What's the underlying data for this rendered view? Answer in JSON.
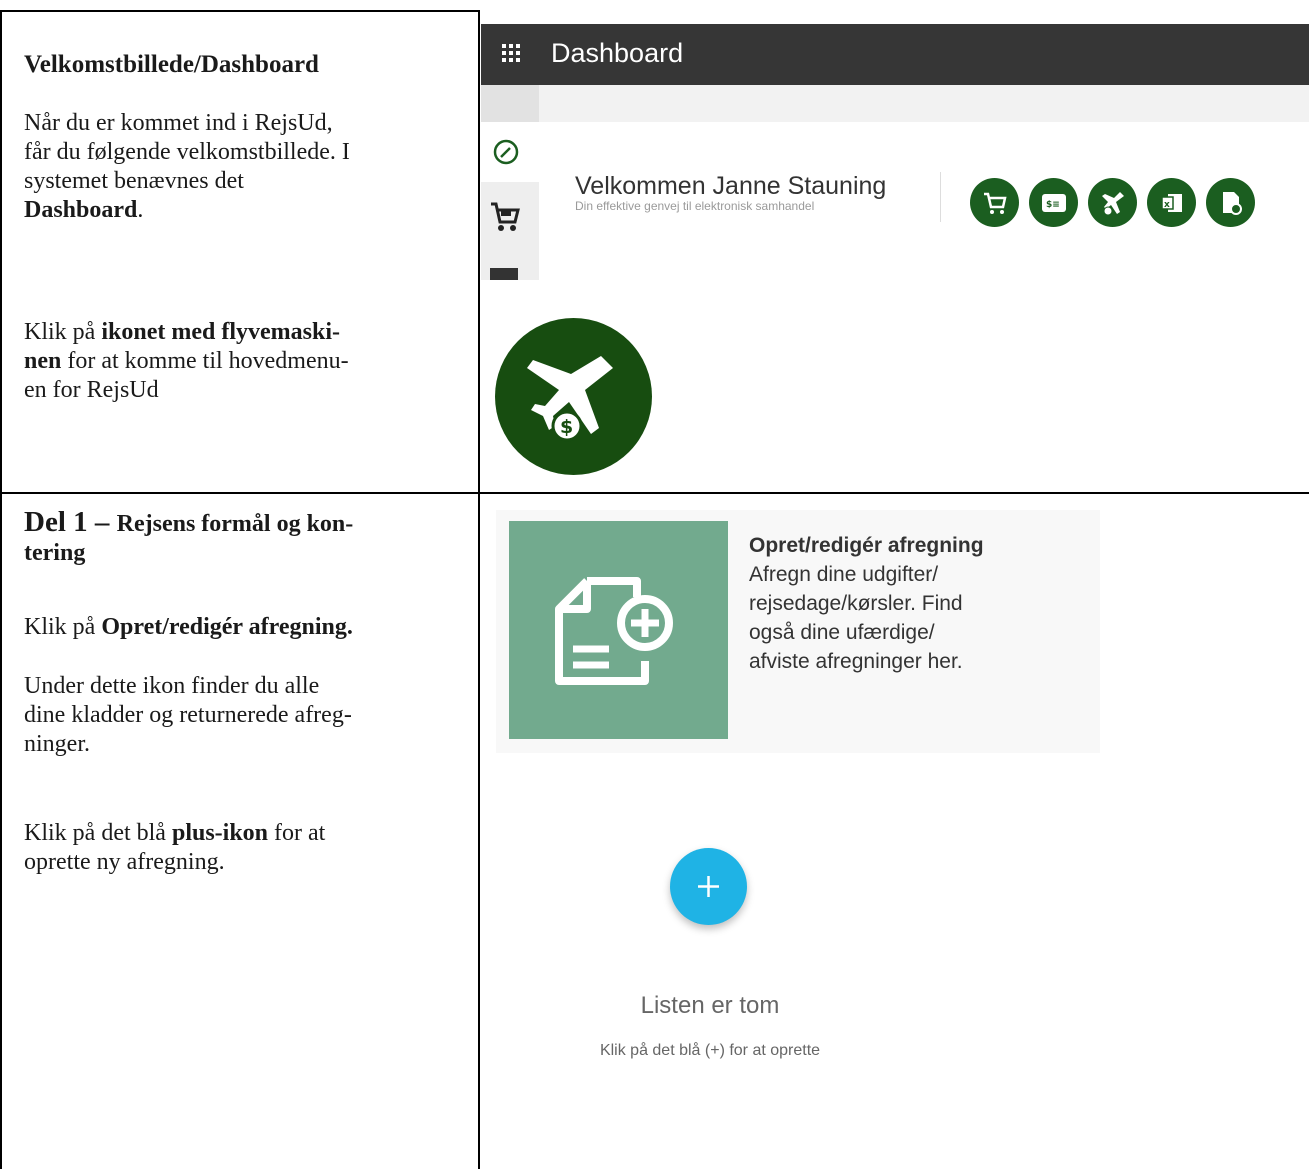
{
  "row1": {
    "left": {
      "heading": "Velkomstbillede/Dashboard",
      "para1_a": "Når du er kommet ind i RejsUd,",
      "para1_b": "får du følgende velkomstbillede. I",
      "para1_c": "systemet benævnes det",
      "para1_bold": "Dashboard",
      "para1_end": ".",
      "para2_a": "Klik på ",
      "para2_bold_a": "ikonet med flyvemaski-",
      "para2_bold_b": "nen",
      "para2_b": " for at komme til hovedmenu-",
      "para2_c": "en for RejsUd"
    },
    "app": {
      "header_title": "Dashboard",
      "welcome_name": "Velkommen Janne Stauning",
      "welcome_tagline": "Din effektive genvej til elektronisk samhandel",
      "icons": [
        "cart-icon",
        "receipt-icon",
        "plane-money-icon",
        "excel-icon",
        "document-icon"
      ]
    }
  },
  "row2": {
    "left": {
      "heading_big": "Del 1 – ",
      "heading_small_a": "Rejsens formål og kon-",
      "heading_small_b": "tering",
      "para1_a": "Klik på ",
      "para1_bold": "Opret/redigér afregning.",
      "para2_a": "Under dette ikon finder du alle",
      "para2_b": "dine kladder og returnerede afreg-",
      "para2_c": "ninger.",
      "para3_a": "Klik på det blå ",
      "para3_bold": "plus-ikon",
      "para3_b": " for at",
      "para3_c": "oprette ny afregning."
    },
    "tile": {
      "title": "Opret/redigér afregning",
      "line1": "Afregn dine udgifter/",
      "line2": "rejsedage/kørsler. Find",
      "line3": "også dine ufærdige/",
      "line4": "afviste afregninger her."
    },
    "empty_state": {
      "title": "Listen er tom",
      "subtitle": "Klik på det blå (+) for at oprette"
    }
  },
  "colors": {
    "dark_green": "#1b5e20",
    "tile_green": "#72aa8e",
    "fab_blue": "#1fb3e5",
    "header_dark": "#363636"
  }
}
